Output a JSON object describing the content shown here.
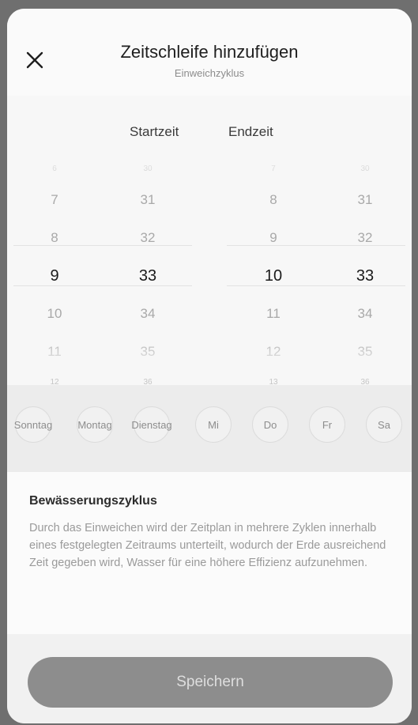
{
  "header": {
    "title": "Zeitschleife hinzufügen",
    "subtitle": "Einweichzyklus",
    "close_icon": "close-icon"
  },
  "picker": {
    "start_label": "Startzeit",
    "end_label": "Endzeit",
    "start_hours": [
      "6",
      "7",
      "8",
      "9",
      "10",
      "11",
      "12"
    ],
    "start_minutes": [
      "30",
      "31",
      "32",
      "33",
      "34",
      "35",
      "36"
    ],
    "end_hours": [
      "7",
      "8",
      "9",
      "10",
      "11",
      "12",
      "13"
    ],
    "end_minutes": [
      "30",
      "31",
      "32",
      "33",
      "34",
      "35",
      "36"
    ],
    "selected_start_hour": "9",
    "selected_start_minute": "33",
    "selected_end_hour": "10",
    "selected_end_minute": "33"
  },
  "days": [
    {
      "line1": "Son",
      "line2": "ntag"
    },
    {
      "line1": "Mon",
      "line2": "tag"
    },
    {
      "line1": "Dien",
      "line2": "stag"
    },
    {
      "line1": "Mi",
      "line2": ""
    },
    {
      "line1": "Do",
      "line2": ""
    },
    {
      "line1": "Fr",
      "line2": ""
    },
    {
      "line1": "Sa",
      "line2": ""
    }
  ],
  "info": {
    "title": "Bewässerungszyklus",
    "text": "Durch das Einweichen wird der Zeitplan in mehrere Zyklen innerhalb eines festgelegten Zeitraums unterteilt, wodurch der Erde ausreichend Zeit gegeben wird, Wasser für eine höhere Effizienz aufzunehmen."
  },
  "footer": {
    "save_label": "Speichern"
  }
}
